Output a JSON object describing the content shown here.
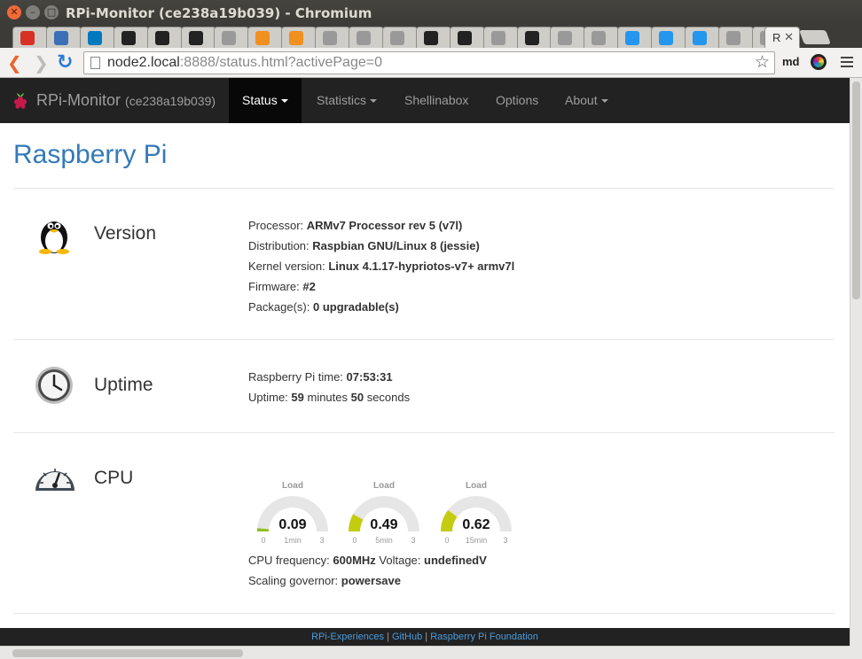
{
  "window": {
    "title": "RPi-Monitor (ce238a19b039) - Chromium"
  },
  "tabs": [
    {
      "icon": "gmail-icon",
      "color": "#d93025"
    },
    {
      "icon": "cloud-icon",
      "color": "#3b6fb6"
    },
    {
      "icon": "trello-icon",
      "color": "#0079bf"
    },
    {
      "icon": "github-icon",
      "color": "#222222"
    },
    {
      "icon": "github-icon",
      "color": "#222222"
    },
    {
      "icon": "github-icon",
      "color": "#222222"
    },
    {
      "icon": "doc-icon",
      "color": "#999999"
    },
    {
      "icon": "orange-square-icon",
      "color": "#f0901e"
    },
    {
      "icon": "orange-square-icon",
      "color": "#f0901e"
    },
    {
      "icon": "doc-icon",
      "color": "#999999"
    },
    {
      "icon": "doc-icon",
      "color": "#999999"
    },
    {
      "icon": "doc-icon",
      "color": "#999999"
    },
    {
      "icon": "github-icon",
      "color": "#222222"
    },
    {
      "icon": "github-icon",
      "color": "#222222"
    },
    {
      "icon": "doc-icon",
      "color": "#999999"
    },
    {
      "icon": "github-icon",
      "color": "#222222"
    },
    {
      "icon": "doc-icon",
      "color": "#999999"
    },
    {
      "icon": "doc-icon",
      "color": "#999999"
    },
    {
      "icon": "docker-icon",
      "color": "#2496ed"
    },
    {
      "icon": "docker-icon",
      "color": "#2496ed"
    },
    {
      "icon": "docker-icon",
      "color": "#2496ed"
    },
    {
      "icon": "doc-icon",
      "color": "#999999"
    },
    {
      "icon": "doc-icon",
      "color": "#999999"
    }
  ],
  "active_tab": {
    "label": "R",
    "close": "✕"
  },
  "toolbar": {
    "url_host": "node2.local",
    "url_rest": ":8888/status.html?activePage=0",
    "extension_label": "md"
  },
  "navbar": {
    "brand": "RPi-Monitor",
    "brand_sub": "(ce238a19b039)",
    "items": [
      "Status",
      "Statistics",
      "Shellinabox",
      "Options",
      "About"
    ]
  },
  "page": {
    "title": "Raspberry Pi"
  },
  "version": {
    "title": "Version",
    "processor_label": "Processor: ",
    "processor": "ARMv7 Processor rev 5 (v7l)",
    "distribution_label": "Distribution: ",
    "distribution": "Raspbian GNU/Linux 8 (jessie)",
    "kernel_label": "Kernel version: ",
    "kernel": "Linux 4.1.17-hypriotos-v7+ armv7l",
    "firmware_label": "Firmware: ",
    "firmware": "#2",
    "packages_label": "Package(s): ",
    "packages": "0 upgradable(s)"
  },
  "uptime": {
    "title": "Uptime",
    "time_label": "Raspberry Pi time: ",
    "time": "07:53:31",
    "uptime_label": "Uptime: ",
    "minutes": "59",
    "minutes_word": " minutes ",
    "seconds": "50",
    "seconds_word": " seconds"
  },
  "cpu": {
    "title": "CPU",
    "gauges": [
      {
        "title": "Load",
        "value": "0.09",
        "value_num": 0.09,
        "min": "0",
        "max": "3",
        "label": "1min",
        "color": "#8fbe1f"
      },
      {
        "title": "Load",
        "value": "0.49",
        "value_num": 0.49,
        "min": "0",
        "max": "3",
        "label": "5min",
        "color": "#c4cc0f"
      },
      {
        "title": "Load",
        "value": "0.62",
        "value_num": 0.62,
        "min": "0",
        "max": "3",
        "label": "15min",
        "color": "#c4cc0f"
      }
    ],
    "freq_label": "CPU frequency: ",
    "freq": "600MHz",
    "voltage_label": " Voltage: ",
    "voltage": "undefinedV",
    "governor_label": "Scaling governor: ",
    "governor": "powersave"
  },
  "footer": {
    "link1": "RPi-Experiences",
    "sep1": " | ",
    "link2": "GitHub",
    "sep2": " | ",
    "link3": "Raspberry Pi Foundation"
  }
}
